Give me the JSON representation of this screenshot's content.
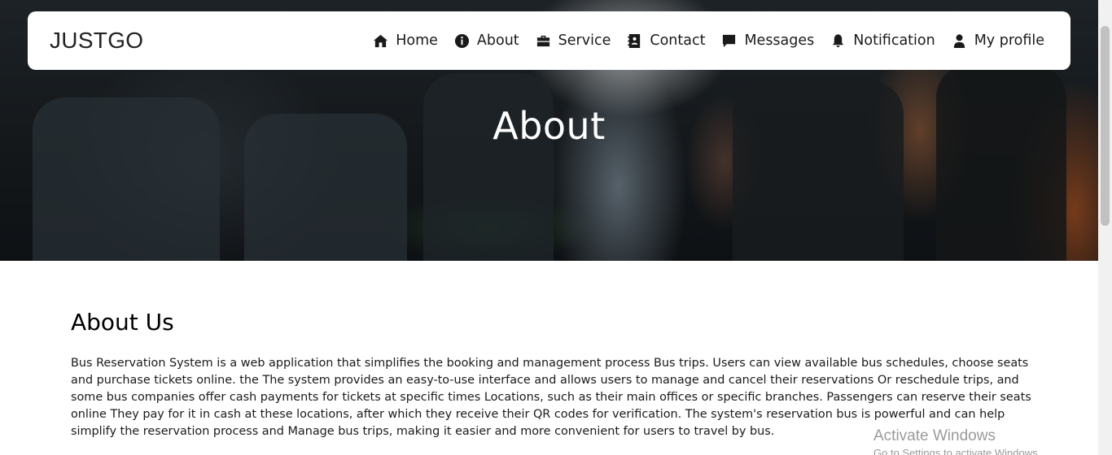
{
  "brand": "JUSTGO",
  "nav": {
    "home": "Home",
    "about": "About",
    "service": "Service",
    "contact": "Contact",
    "messages": "Messages",
    "notification": "Notification",
    "profile": "My profile"
  },
  "hero": {
    "title": "About"
  },
  "about": {
    "heading": "About Us",
    "body": "Bus Reservation System is a web application that simplifies the booking and management process Bus trips. Users can view available bus schedules, choose seats and purchase tickets online. the The system provides an easy-to-use interface and allows users to manage and cancel their reservations Or reschedule trips, and some bus companies offer cash payments for tickets at specific times Locations, such as their main offices or specific branches. Passengers can reserve their seats online They pay for it in cash at these locations, after which they receive their QR codes for verification. The system's reservation bus is powerful and can help simplify the reservation process and Manage bus trips, making it easier and more convenient for users to travel by bus."
  },
  "watermark": {
    "title": "Activate Windows",
    "subtitle": "Go to Settings to activate Windows."
  },
  "icons": {
    "home": "house-icon",
    "about": "info-circle-icon",
    "service": "briefcase-icon",
    "contact": "contact-card-icon",
    "messages": "message-bubble-icon",
    "notification": "bell-icon",
    "profile": "user-icon"
  },
  "colors": {
    "navbar_bg": "#ffffff",
    "text": "#1a1a1a",
    "hero_text": "#ffffff"
  }
}
